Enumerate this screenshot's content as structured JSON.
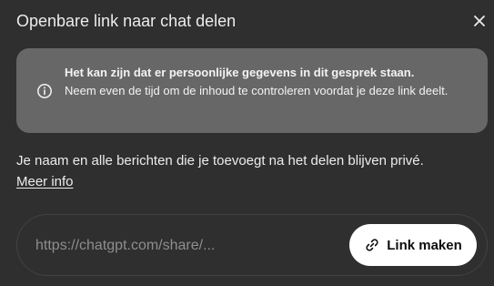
{
  "dialog": {
    "title": "Openbare link naar chat delen",
    "close_icon": "close-icon"
  },
  "warning": {
    "icon": "info-icon",
    "heading": "Het kan zijn dat er persoonlijke gegevens in dit gesprek staan.",
    "body": "Neem even de tijd om de inhoud te controleren voordat je deze link deelt."
  },
  "info": {
    "text": "Je naam en alle berichten die je toevoegt na het delen blijven privé.",
    "link_label": "Meer info"
  },
  "share": {
    "url_value": "https://chatgpt.com/share/...",
    "button_icon": "link-icon",
    "button_label": "Link maken"
  },
  "colors": {
    "dialog_background": "#2f2f2f",
    "warning_background": "#676767",
    "button_background": "#ffffff",
    "text": "#ececec",
    "muted_text": "#8e8e8e"
  }
}
